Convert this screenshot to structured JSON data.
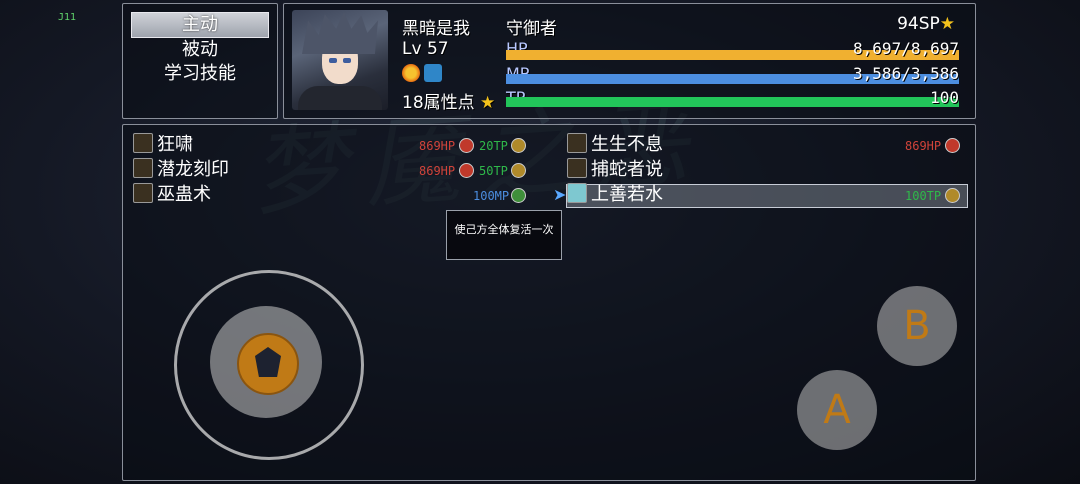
{
  "corner_label": "J11",
  "background_title": "梦魇之恶",
  "command_menu": {
    "items": [
      {
        "label": "主动",
        "selected": true
      },
      {
        "label": "被动",
        "selected": false
      },
      {
        "label": "学习技能",
        "selected": false
      }
    ]
  },
  "status": {
    "name": "黑暗是我",
    "class": "守御者",
    "level_label": "Lv",
    "level": "57",
    "attr_points": "18属性点",
    "sp": "94SP",
    "hp": {
      "label": "HP",
      "text": "8,697/8,697",
      "ratio": 1.0,
      "color": "#f0b030"
    },
    "mp": {
      "label": "MP",
      "text": "3,586/3,586",
      "ratio": 1.0,
      "color": "#4c8ee0"
    },
    "tp": {
      "label": "TP",
      "text": "100",
      "ratio": 1.0,
      "color": "#22c55a"
    }
  },
  "skills": {
    "left": [
      {
        "name": "狂啸",
        "cost1": "869HP",
        "cost1_color": "#d0433a",
        "cost2": "20TP",
        "cost2_color": "#2fb84a"
      },
      {
        "name": "潜龙刻印",
        "cost1": "869HP",
        "cost1_color": "#d0433a",
        "cost2": "50TP",
        "cost2_color": "#2fb84a"
      },
      {
        "name": "巫蛊术",
        "cost1": "",
        "cost1_color": "",
        "cost2": "100MP",
        "cost2_color": "#4c8ee0"
      }
    ],
    "right": [
      {
        "name": "生生不息",
        "cost": "869HP",
        "cost_color": "#d0433a"
      },
      {
        "name": "捕蛇者说",
        "cost": "",
        "cost_color": ""
      },
      {
        "name": "上善若水",
        "cost": "100TP",
        "cost_color": "#2fb84a",
        "selected": true
      }
    ]
  },
  "tooltip": "使己方全体复活一次",
  "controls": {
    "button_b": "B",
    "button_a": "A"
  }
}
